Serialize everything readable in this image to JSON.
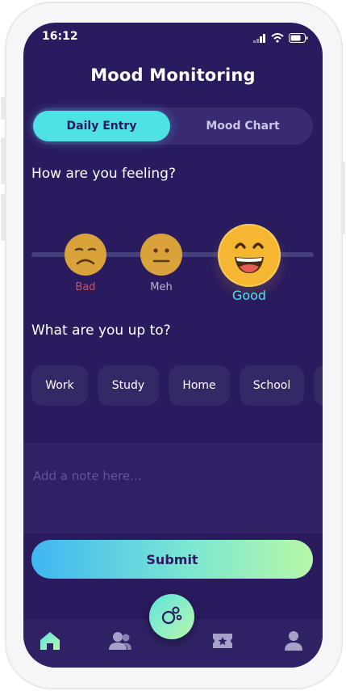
{
  "status_bar": {
    "time": "16:12"
  },
  "header": {
    "title": "Mood Monitoring"
  },
  "tabs": [
    {
      "label": "Daily Entry",
      "active": true
    },
    {
      "label": "Mood Chart",
      "active": false
    }
  ],
  "feeling": {
    "question": "How are you feeling?",
    "moods": [
      {
        "label": "Bad",
        "icon": "sad-face-icon",
        "color": "#c0576b"
      },
      {
        "label": "Meh",
        "icon": "neutral-face-icon",
        "color": "#b9b3cf"
      },
      {
        "label": "Good",
        "icon": "happy-face-icon",
        "color": "#4ee2e4",
        "selected": true
      }
    ]
  },
  "activities": {
    "question": "What are you up to?",
    "chips": [
      "Work",
      "Study",
      "Home",
      "School"
    ]
  },
  "note": {
    "placeholder": "Add a note here..."
  },
  "submit": {
    "label": "Submit"
  },
  "nav": {
    "items": [
      "home-icon",
      "users-icon",
      "ticket-icon",
      "profile-icon"
    ],
    "fab_icon": "bubbles-icon"
  },
  "colors": {
    "background": "#2a1a5e",
    "accent": "#4ee2e4",
    "emoji": "#f5b731"
  }
}
